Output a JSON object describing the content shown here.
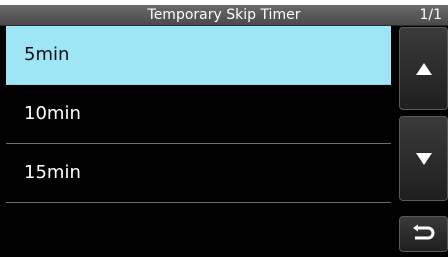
{
  "header": {
    "title": "Temporary Skip Timer",
    "page_indicator": "1/1"
  },
  "list": {
    "items": [
      {
        "label": "5min",
        "selected": true
      },
      {
        "label": "10min",
        "selected": false
      },
      {
        "label": "15min",
        "selected": false
      }
    ]
  },
  "nav": {
    "up_icon": "triangle-up-icon",
    "down_icon": "triangle-down-icon",
    "back_icon": "return-arrow-icon"
  },
  "colors": {
    "selected_row": "#9ee6f6",
    "background": "#000000",
    "titlebar": "#5a5a5a"
  }
}
